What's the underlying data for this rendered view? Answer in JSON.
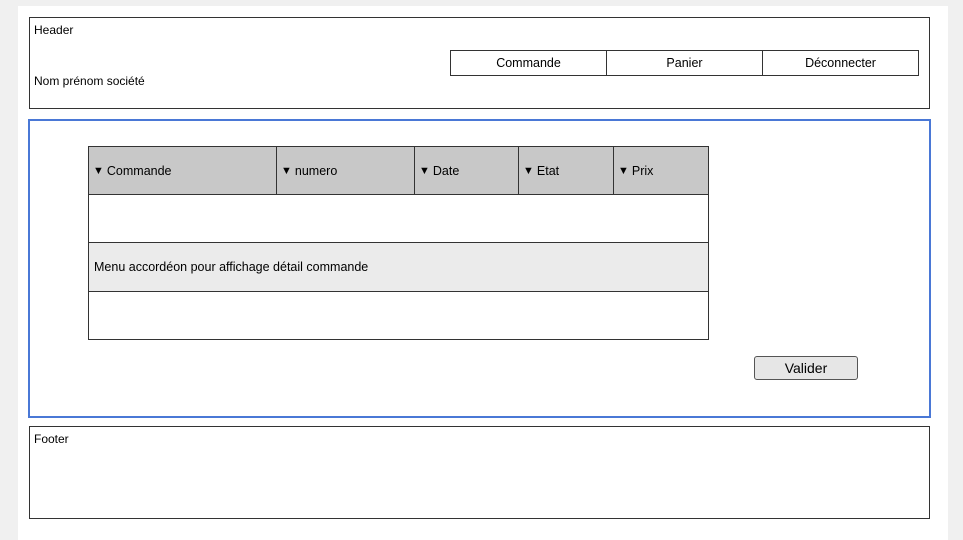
{
  "header": {
    "title": "Header",
    "user_info": "Nom prénom société",
    "nav": [
      {
        "label": "Commande"
      },
      {
        "label": "Panier"
      },
      {
        "label": "Déconnecter"
      }
    ]
  },
  "table": {
    "sort_icon": "▼",
    "columns": [
      {
        "label": "Commande"
      },
      {
        "label": "numero"
      },
      {
        "label": "Date"
      },
      {
        "label": "Etat"
      },
      {
        "label": "Prix"
      }
    ],
    "accordion_label": "Menu accordéon pour affichage détail commande"
  },
  "validate_label": "Valider",
  "footer": {
    "title": "Footer"
  }
}
